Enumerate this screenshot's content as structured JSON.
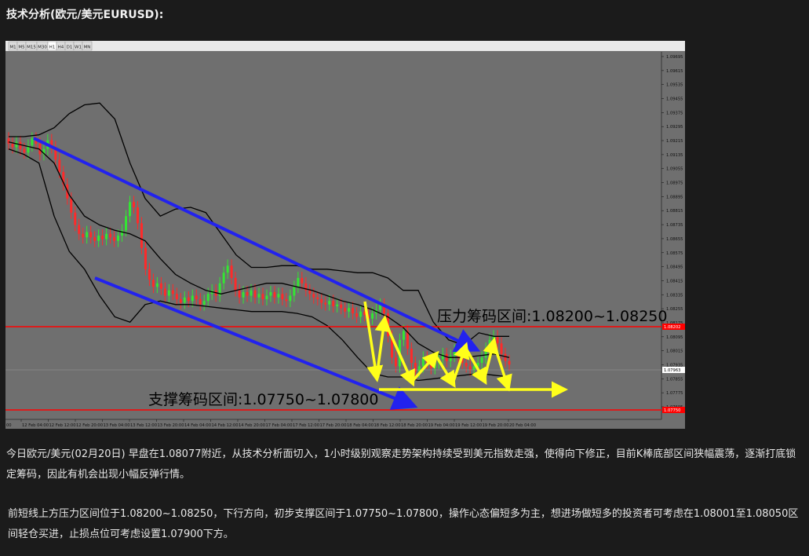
{
  "header": {
    "title": "技术分析(欧元/美元EURUSD):"
  },
  "toolbar": {
    "timeframes": [
      "M1",
      "M5",
      "M15",
      "M30",
      "H1",
      "H4",
      "D1",
      "W1",
      "MN"
    ],
    "active": "H1"
  },
  "chart_data": {
    "type": "candlestick",
    "symbol": "EURUSD",
    "timeframe": "H1",
    "ylim": [
      1.0765,
      1.0973
    ],
    "y_ticks": [
      1.08695,
      1.08615,
      1.08535,
      1.08455,
      1.08375,
      1.08295,
      1.08215,
      1.08135,
      1.08055,
      1.07975,
      1.07895,
      1.07815,
      1.07735,
      1.07655,
      1.07575,
      1.07495,
      1.07415,
      1.07335,
      1.07255,
      1.07175,
      1.07095,
      1.07015,
      1.06935,
      1.06855,
      1.06775,
      1.06695
    ],
    "y_tick_labels": [
      "1.09695",
      "1.09615",
      "1.09535",
      "1.09455",
      "1.09375",
      "1.09295",
      "1.09215",
      "1.09135",
      "1.09055",
      "1.08975",
      "1.08895",
      "1.08815",
      "1.08735",
      "1.08655",
      "1.08575",
      "1.08495",
      "1.08415",
      "1.08335",
      "1.08255",
      "1.08175",
      "1.08095",
      "1.08015",
      "1.07935",
      "1.07855",
      "1.07775",
      "1.07695"
    ],
    "x_tick_labels": [
      "12 Feb 04:00",
      "12 Feb 12:00",
      "12 Feb 20:00",
      "13 Feb 04:00",
      "13 Feb 12:00",
      "13 Feb 20:00",
      "14 Feb 04:00",
      "14 Feb 12:00",
      "14 Feb 20:00",
      "17 Feb 04:00",
      "17 Feb 12:00",
      "17 Feb 20:00",
      "18 Feb 04:00",
      "18 Feb 12:00",
      "18 Feb 20:00",
      "19 Feb 04:00",
      "19 Feb 12:00",
      "19 Feb 20:00",
      "20 Feb 04:00"
    ],
    "x_first_label": "00",
    "current_price_label": "1.07963",
    "resistance_line_label": "1.08202",
    "support_line_label": "1.07750",
    "close": [
      1.0921,
      1.0919,
      1.0922,
      1.0918,
      1.0916,
      1.092,
      1.0924,
      1.0921,
      1.0915,
      1.0918,
      1.0923,
      1.0919,
      1.0912,
      1.0905,
      1.0898,
      1.089,
      1.0882,
      1.0875,
      1.087,
      1.0868,
      1.0871,
      1.0868,
      1.0866,
      1.0869,
      1.0867,
      1.087,
      1.0868,
      1.0866,
      1.0869,
      1.0872,
      1.088,
      1.0888,
      1.0885,
      1.0876,
      1.0862,
      1.085,
      1.0844,
      1.084,
      1.0842,
      1.0839,
      1.0835,
      1.0838,
      1.0836,
      1.0833,
      1.0831,
      1.0834,
      1.0832,
      1.0835,
      1.0833,
      1.083,
      1.0832,
      1.0836,
      1.0838,
      1.0835,
      1.0842,
      1.0848,
      1.0852,
      1.0845,
      1.0838,
      1.0834,
      1.0837,
      1.0835,
      1.0838,
      1.0834,
      1.0836,
      1.0833,
      1.0835,
      1.0837,
      1.0834,
      1.0836,
      1.0833,
      1.0832,
      1.0835,
      1.084,
      1.0845,
      1.0842,
      1.0838,
      1.0836,
      1.0834,
      1.0833,
      1.0831,
      1.083,
      1.0832,
      1.0829,
      1.083,
      1.0828,
      1.0826,
      1.0828,
      1.0825,
      1.0823,
      1.0826,
      1.0824,
      1.0822,
      1.0825,
      1.0827,
      1.083,
      1.0825,
      1.0812,
      1.08,
      1.0795,
      1.081,
      1.0815,
      1.0805,
      1.0797,
      1.0792,
      1.0795,
      1.08,
      1.0797,
      1.0794,
      1.0797,
      1.0799,
      1.0802,
      1.0798,
      1.0801,
      1.0804,
      1.08,
      1.0797,
      1.0795,
      1.0793,
      1.0795,
      1.0797,
      1.08,
      1.0805,
      1.081,
      1.0812,
      1.0808,
      1.0802,
      1.0798,
      1.0796
    ],
    "bollinger": {
      "upper": [
        1.0925,
        1.0925,
        1.0926,
        1.093,
        1.0938,
        1.0943,
        1.0944,
        1.0935,
        1.091,
        1.089,
        1.088,
        1.0884,
        1.0885,
        1.0882,
        1.087,
        1.0858,
        1.0851,
        1.0851,
        1.0852,
        1.0852,
        1.085,
        1.085,
        1.0849,
        1.0848,
        1.0848,
        1.0845,
        1.0838,
        1.0838,
        1.082,
        1.081,
        1.0807,
        1.0814,
        1.0812,
        1.0812
      ],
      "middle": [
        1.0922,
        1.092,
        1.0918,
        1.091,
        1.0892,
        1.088,
        1.0875,
        1.0872,
        1.087,
        1.0866,
        1.0856,
        1.0847,
        1.0842,
        1.0838,
        1.0836,
        1.0838,
        1.084,
        1.0842,
        1.0842,
        1.084,
        1.0838,
        1.0835,
        1.0832,
        1.083,
        1.0827,
        1.0823,
        1.0817,
        1.0808,
        1.0803,
        1.08,
        1.08,
        1.0801,
        1.0802,
        1.08
      ],
      "lower": [
        1.0918,
        1.0915,
        1.091,
        1.088,
        1.086,
        1.085,
        1.0835,
        1.0823,
        1.082,
        1.083,
        1.0832,
        1.083,
        1.083,
        1.0829,
        1.0828,
        1.0827,
        1.0826,
        1.0826,
        1.0826,
        1.0825,
        1.0823,
        1.0818,
        1.081,
        1.08,
        1.0791,
        1.0789,
        1.0789,
        1.0787,
        1.0788,
        1.0789,
        1.079,
        1.0791,
        1.079,
        1.0789
      ]
    },
    "annotations": {
      "resistance": {
        "label": "压力筹码区间:1.08200~1.08250",
        "price": 1.082
      },
      "support": {
        "label": "支撑筹码区间:1.07750~1.07800",
        "price": 1.0775
      }
    },
    "colors": {
      "background": "#6f6f6f",
      "bull": "#33e633",
      "bear": "#ff2a2a",
      "bands": "#000000",
      "channel": "#2222ee",
      "pattern": "#ffff1a",
      "levels": "#ff0000"
    }
  },
  "text": {
    "p1": "今日欧元/美元(02月20日) 早盘在1.08077附近，从技术分析面切入，1小时级别观察走势架构持续受到美元指数走强，使得向下修正，目前K棒底部区间狭幅震荡，逐渐打底锁定筹码，因此有机会出现小幅反弹行情。",
    "p2": "前短线上方压力区间位于1.08200~1.08250，下行方向，初步支撑区间于1.07750~1.07800，操作心态偏短多为主，想进场做短多的投资者可考虑在1.08001至1.08050区间轻仓买进，止损点位可考虑设置1.07900下方。"
  }
}
